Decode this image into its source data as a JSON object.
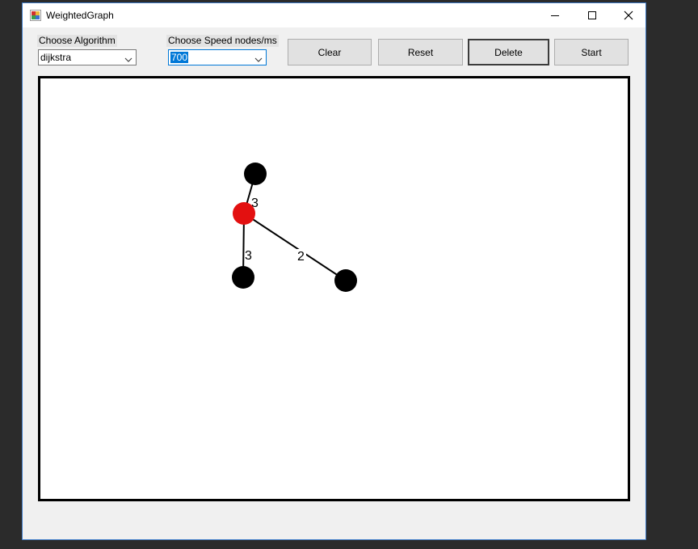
{
  "window": {
    "title": "WeightedGraph",
    "controls": [
      "minimize",
      "maximize",
      "close"
    ]
  },
  "algorithm": {
    "label": "Choose Algorithm",
    "selected": "dijkstra"
  },
  "speed": {
    "label": "Choose Speed nodes/ms",
    "selected": "700"
  },
  "toolbar": {
    "clear_label": "Clear",
    "reset_label": "Reset",
    "delete_label": "Delete",
    "start_label": "Start"
  },
  "graph": {
    "edges": [
      {
        "weight": "3"
      },
      {
        "weight": "3"
      },
      {
        "weight": "2"
      }
    ]
  },
  "colors": {
    "node_default": "#000000",
    "node_source": "#e31010",
    "edge": "#000000",
    "canvas_bg": "#ffffff"
  }
}
